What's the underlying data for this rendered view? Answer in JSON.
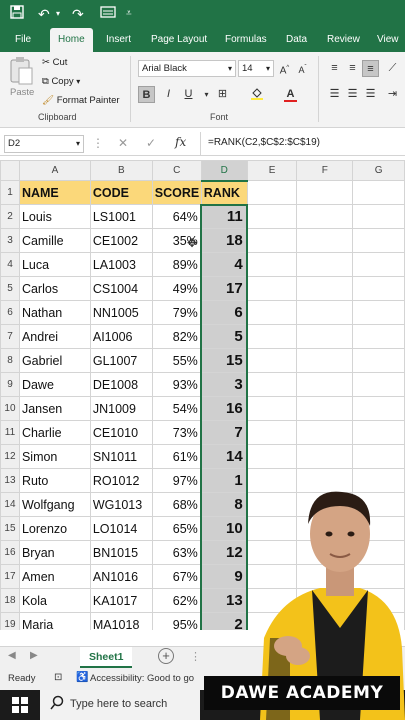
{
  "quick_access": {
    "save_icon": "save-icon",
    "undo_icon": "undo-icon",
    "customize_icon": "customize-qat-icon"
  },
  "menu": {
    "tabs": [
      "File",
      "Home",
      "Insert",
      "Page Layout",
      "Formulas",
      "Data",
      "Review",
      "View"
    ],
    "active": "Home"
  },
  "ribbon": {
    "clipboard": {
      "paste": "Paste",
      "cut": "Cut",
      "copy": "Copy",
      "format_painter": "Format Painter",
      "group": "Clipboard"
    },
    "font": {
      "name": "Arial Black",
      "size": "14",
      "group": "Font",
      "bold": "B",
      "italic": "I",
      "underline": "U"
    }
  },
  "formula_bar": {
    "name_box": "D2",
    "fx": "fx",
    "formula": "=RANK(C2,$C$2:$C$19)"
  },
  "columns": [
    "A",
    "B",
    "C",
    "D",
    "E",
    "F",
    "G"
  ],
  "header_row": {
    "name": "NAME",
    "code": "CODE",
    "score": "SCORE",
    "rank": "RANK"
  },
  "rows": [
    {
      "name": "Louis",
      "code": "LS1001",
      "score": "64%",
      "rank": "11"
    },
    {
      "name": "Camille",
      "code": "CE1002",
      "score": "35%",
      "rank": "18"
    },
    {
      "name": "Luca",
      "code": "LA1003",
      "score": "89%",
      "rank": "4"
    },
    {
      "name": "Carlos",
      "code": "CS1004",
      "score": "49%",
      "rank": "17"
    },
    {
      "name": "Nathan",
      "code": "NN1005",
      "score": "79%",
      "rank": "6"
    },
    {
      "name": "Andrei",
      "code": "AI1006",
      "score": "82%",
      "rank": "5"
    },
    {
      "name": "Gabriel",
      "code": "GL1007",
      "score": "55%",
      "rank": "15"
    },
    {
      "name": "Dawe",
      "code": "DE1008",
      "score": "93%",
      "rank": "3"
    },
    {
      "name": "Jansen",
      "code": "JN1009",
      "score": "54%",
      "rank": "16"
    },
    {
      "name": "Charlie",
      "code": "CE1010",
      "score": "73%",
      "rank": "7"
    },
    {
      "name": "Simon",
      "code": "SN1011",
      "score": "61%",
      "rank": "14"
    },
    {
      "name": "Ruto",
      "code": "RO1012",
      "score": "97%",
      "rank": "1"
    },
    {
      "name": "Wolfgang",
      "code": "WG1013",
      "score": "68%",
      "rank": "8"
    },
    {
      "name": "Lorenzo",
      "code": "LO1014",
      "score": "65%",
      "rank": "10"
    },
    {
      "name": "Bryan",
      "code": "BN1015",
      "score": "63%",
      "rank": "12"
    },
    {
      "name": "Amen",
      "code": "AN1016",
      "score": "67%",
      "rank": "9"
    },
    {
      "name": "Kola",
      "code": "KA1017",
      "score": "62%",
      "rank": "13"
    },
    {
      "name": "Maria",
      "code": "MA1018",
      "score": "95%",
      "rank": "2"
    }
  ],
  "sheet": {
    "tab": "Sheet1"
  },
  "status": {
    "ready": "Ready",
    "accessibility": "Accessibility: Good to go"
  },
  "taskbar": {
    "search_placeholder": "Type here to search"
  },
  "overlay": {
    "brand": "DAWE ACADEMY"
  },
  "colors": {
    "excel_green": "#217346",
    "header_fill": "#fbd87a",
    "rank_fill": "#cfcfcf"
  }
}
